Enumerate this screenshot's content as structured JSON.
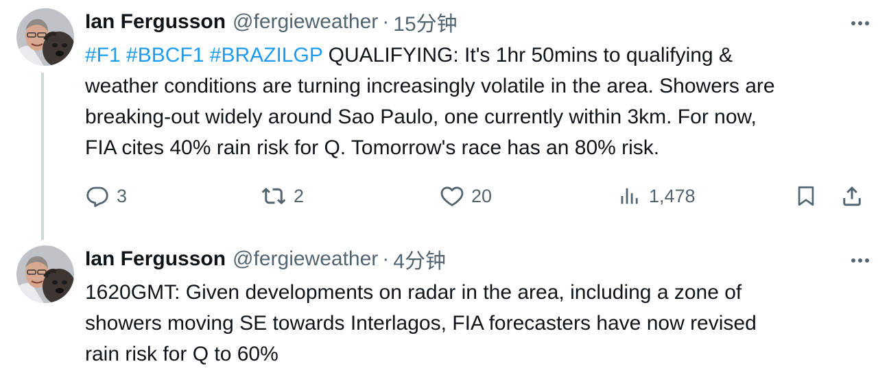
{
  "tweets": [
    {
      "author": {
        "display_name": "Ian Fergusson",
        "handle": "@fergieweather",
        "separator": "·",
        "time": "15分钟"
      },
      "text": {
        "hashtags": [
          "#F1",
          "#BBCF1",
          "#BRAZILGP"
        ],
        "line1_rest": "QUALIFYING: It's 1hr 50mins to qualifying &",
        "line2": "weather conditions are turning increasingly volatile in the area. Showers are",
        "line3": "breaking-out widely around Sao Paulo, one currently within 3km. For now,",
        "line4": "FIA cites 40% rain risk for Q. Tomorrow's race has an 80% risk."
      },
      "actions": {
        "replies": "3",
        "retweets": "2",
        "likes": "20",
        "views": "1,478"
      },
      "icons": [
        "more-icon",
        "reply-icon",
        "retweet-icon",
        "like-icon",
        "views-icon",
        "bookmark-icon",
        "share-icon"
      ]
    },
    {
      "author": {
        "display_name": "Ian Fergusson",
        "handle": "@fergieweather",
        "separator": "·",
        "time": "4分钟"
      },
      "text": {
        "line1": "1620GMT: Given developments on radar in the area, including a zone of",
        "line2": "showers moving SE towards Interlagos, FIA forecasters have now revised",
        "line3": "rain risk for Q to 60%"
      },
      "icons": [
        "more-icon"
      ]
    }
  ],
  "colors": {
    "link": "#1d9bf0",
    "text": "#0f1419",
    "secondary": "#536471",
    "thread_line": "#cfd9de"
  }
}
